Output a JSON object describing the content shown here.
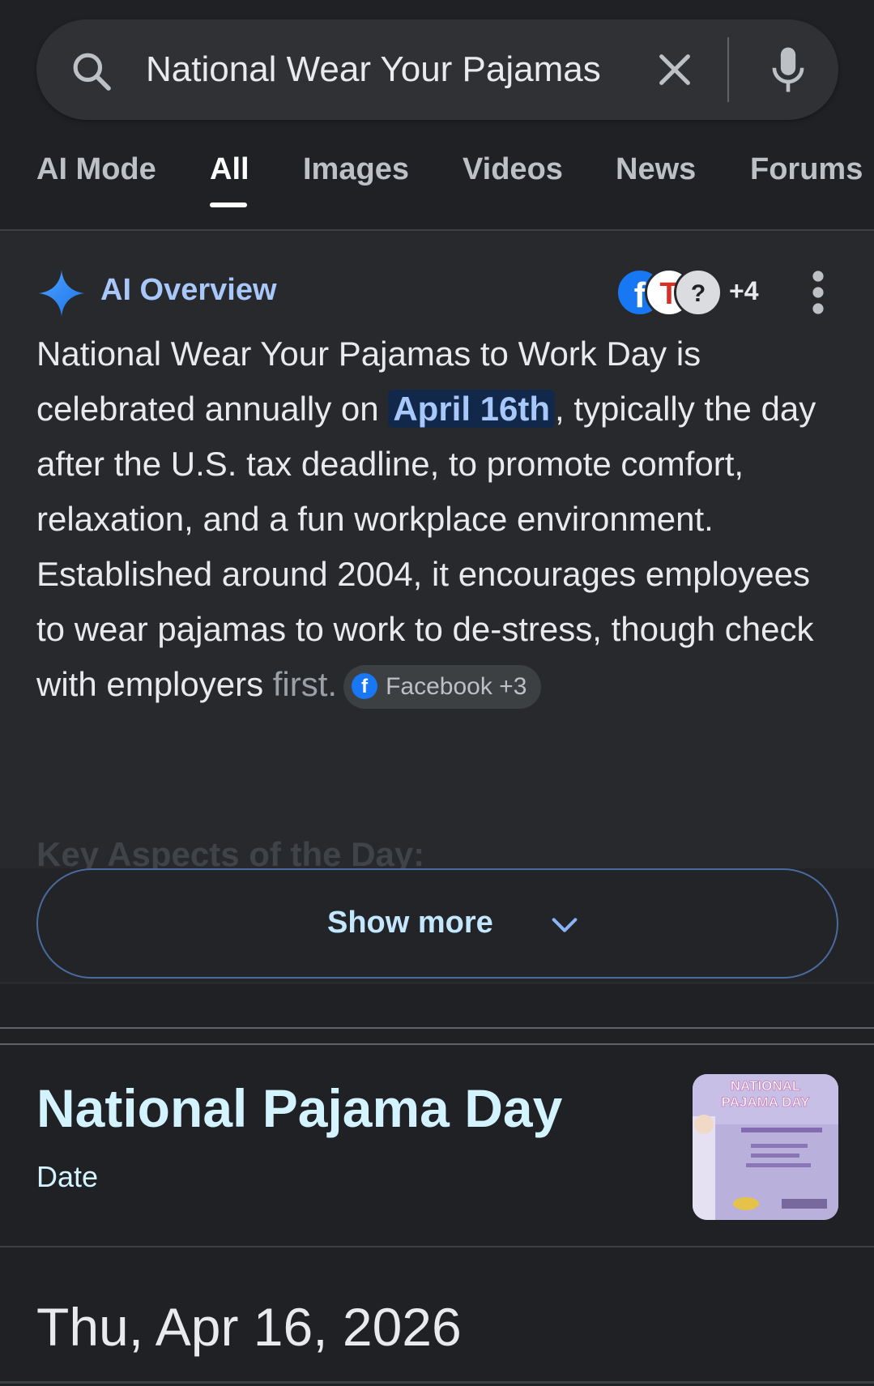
{
  "search": {
    "query": "National Wear Your Pajamas",
    "icons": [
      "search-icon",
      "close-icon",
      "mic-icon"
    ]
  },
  "tabs": [
    {
      "label": "AI Mode",
      "active": false
    },
    {
      "label": "All",
      "active": true
    },
    {
      "label": "Images",
      "active": false
    },
    {
      "label": "Videos",
      "active": false
    },
    {
      "label": "News",
      "active": false
    },
    {
      "label": "Forums",
      "active": false
    }
  ],
  "ai_overview": {
    "title": "AI Overview",
    "sources_more": "+4",
    "text_1": "National Wear Your Pajamas to Work Day is celebrated annually on ",
    "highlight": "April 16th",
    "text_2": ", typically the day after the U.S. tax deadline, to promote comfort, relaxation, and a fun workplace environment. Established around 2004, it encourages employees to wear pajamas to work to de-stress, though check with employers ",
    "text_3": "first.",
    "source_chip": "Facebook +3",
    "faded_heading": "Key Aspects of the Day:",
    "show_more": "Show more"
  },
  "knowledge_card": {
    "title": "National Pajama Day",
    "subtitle": "Date",
    "date": "Thu, Apr 16, 2026",
    "thumbnail_text": "NATIONAL PAJAMA DAY"
  },
  "colors": {
    "background": "#202124",
    "accent_blue": "#a8c7fa",
    "card_title": "#d2f3ff"
  }
}
